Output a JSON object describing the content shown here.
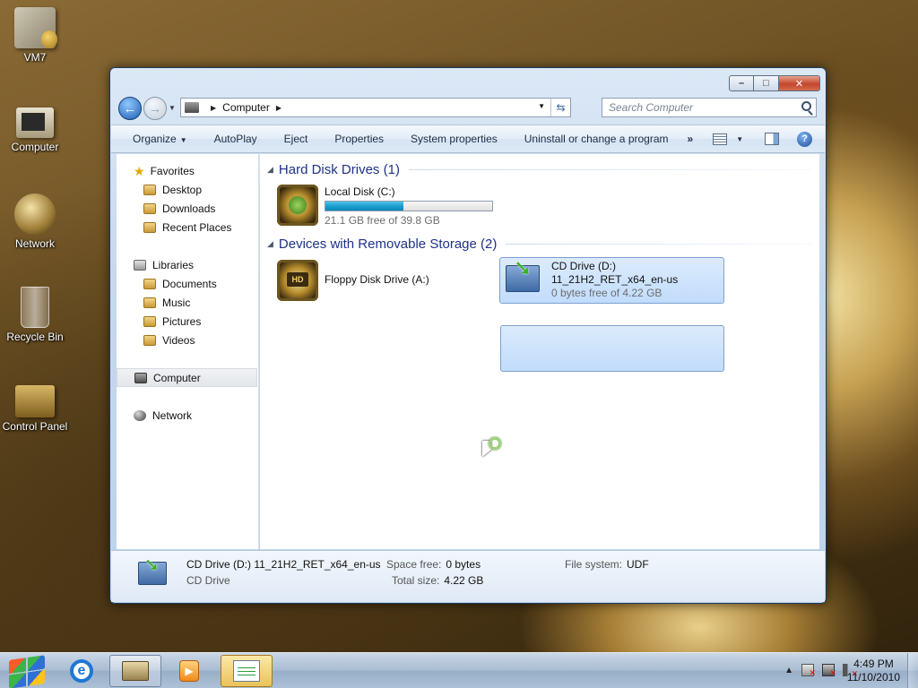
{
  "desktop": {
    "icons": [
      {
        "label": "VM7"
      },
      {
        "label": "Computer"
      },
      {
        "label": "Network"
      },
      {
        "label": "Recycle Bin"
      },
      {
        "label": "Control Panel"
      }
    ]
  },
  "window": {
    "address": {
      "crumbs": [
        "Computer"
      ]
    },
    "search": {
      "placeholder": "Search Computer"
    },
    "toolbar": {
      "organize": "Organize",
      "autoplay": "AutoPlay",
      "eject": "Eject",
      "properties": "Properties",
      "system_properties": "System properties",
      "uninstall": "Uninstall or change a program",
      "more": "»"
    },
    "nav": {
      "favorites": "Favorites",
      "desktop": "Desktop",
      "downloads": "Downloads",
      "recent_places": "Recent Places",
      "libraries": "Libraries",
      "documents": "Documents",
      "music": "Music",
      "pictures": "Pictures",
      "videos": "Videos",
      "computer": "Computer",
      "network": "Network"
    },
    "groups": {
      "hard_disk": "Hard Disk Drives (1)",
      "removable": "Devices with Removable Storage (2)"
    },
    "drives": {
      "local_disk": {
        "name": "Local Disk (C:)",
        "free_text": "21.1 GB free of 39.8 GB",
        "used_fraction": 0.47
      },
      "floppy": {
        "name": "Floppy Disk Drive (A:)"
      },
      "cd": {
        "name": "CD Drive (D:)",
        "volume": "11_21H2_RET_x64_en-us",
        "free_text": "0 bytes free of 4.22 GB"
      }
    },
    "details": {
      "title": "CD Drive (D:) 11_21H2_RET_x64_en-us",
      "type": "CD Drive",
      "space_free_label": "Space free:",
      "space_free_value": "0 bytes",
      "total_size_label": "Total size:",
      "total_size_value": "4.22 GB",
      "file_system_label": "File system:",
      "file_system_value": "UDF"
    }
  },
  "taskbar": {
    "time": "4:49 PM",
    "date": "11/10/2010",
    "tray_arrow": "▲"
  }
}
